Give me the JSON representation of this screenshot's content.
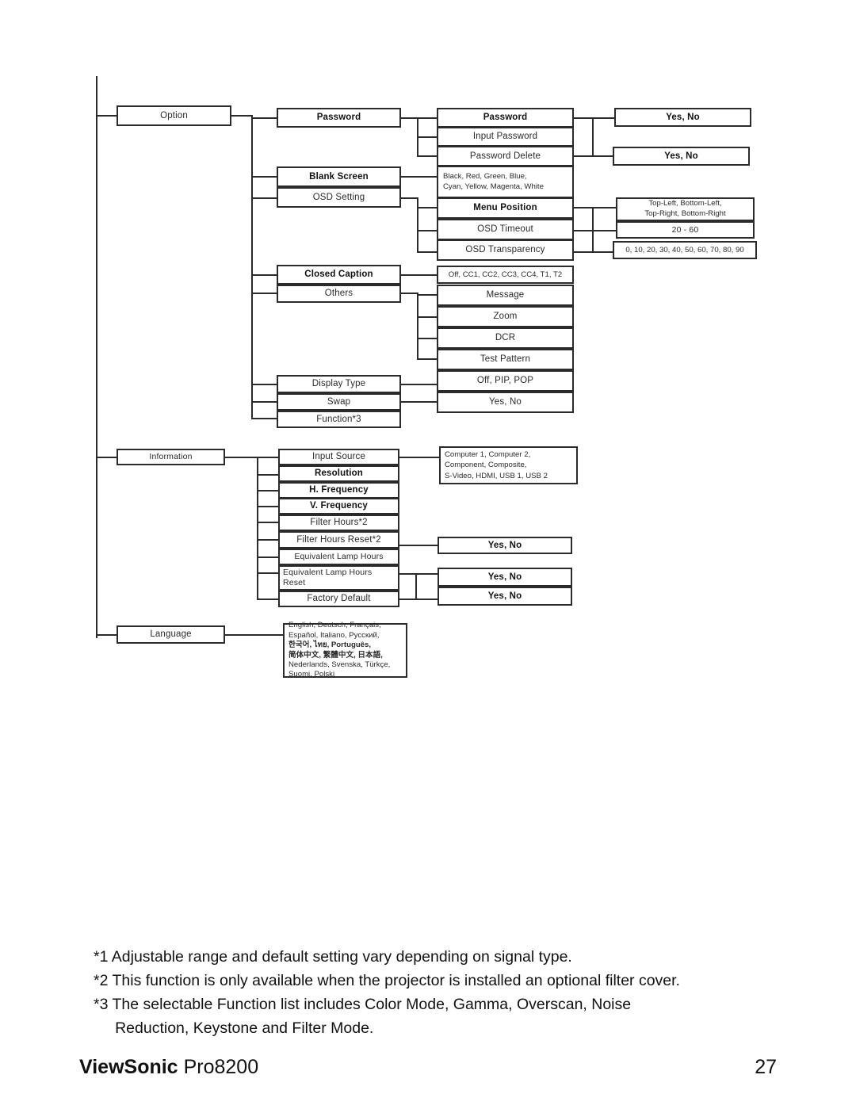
{
  "document": {
    "page_number": "27",
    "brand": "ViewSonic",
    "model": "Pro8200"
  },
  "footnotes": [
    "*1 Adjustable range and default setting vary depending on signal type.",
    "*2 This function is only available when the projector is installed an optional filter cover.",
    "*3 The selectable Function list includes Color Mode, Gamma, Overscan, Noise",
    "     Reduction, Keystone and Filter Mode."
  ],
  "menu_tree": {
    "level1": [
      {
        "id": "option",
        "label": "Option"
      },
      {
        "id": "information",
        "label": "Information"
      },
      {
        "id": "language",
        "label": "Language"
      }
    ],
    "option_items": [
      {
        "id": "password",
        "label": "Password"
      },
      {
        "id": "blank-screen",
        "label": "Blank Screen"
      },
      {
        "id": "osd-setting",
        "label": "OSD Setting"
      },
      {
        "id": "closed-caption",
        "label": "Closed Caption"
      },
      {
        "id": "others",
        "label": "Others"
      },
      {
        "id": "display-type",
        "label": "Display Type"
      },
      {
        "id": "swap",
        "label": "Swap"
      },
      {
        "id": "function3",
        "label": "Function*3"
      }
    ],
    "password_sub": [
      {
        "id": "password-sub",
        "label": "Password"
      },
      {
        "id": "input-password",
        "label": "Input Password"
      },
      {
        "id": "password-delete",
        "label": "Password Delete"
      }
    ],
    "blank_screen_values": "Black, Red, Green, Blue,\nCyan, Yellow, Magenta, White",
    "osd_setting_sub": [
      {
        "id": "menu-position",
        "label": "Menu Position"
      },
      {
        "id": "osd-timeout",
        "label": "OSD Timeout"
      },
      {
        "id": "osd-transparency",
        "label": "OSD Transparency"
      }
    ],
    "closed_caption_values": "Off, CC1, CC2, CC3, CC4, T1, T2",
    "others_sub": [
      {
        "id": "message",
        "label": "Message"
      },
      {
        "id": "zoom",
        "label": "Zoom"
      },
      {
        "id": "dcr",
        "label": "DCR"
      },
      {
        "id": "test-pattern",
        "label": "Test Pattern"
      }
    ],
    "display_type_values": "Off, PIP, POP",
    "swap_values": "Yes, No",
    "password_yes_no": "Yes, No",
    "password_delete_yes_no": "Yes, No",
    "menu_position_values": "Top-Left, Bottom-Left,\nTop-Right, Bottom-Right",
    "osd_timeout_values": "20 - 60",
    "osd_transparency_values": "0, 10, 20, 30, 40, 50, 60, 70, 80, 90",
    "information_items": [
      {
        "id": "input-source",
        "label": "Input Source"
      },
      {
        "id": "resolution",
        "label": "Resolution"
      },
      {
        "id": "h-frequency",
        "label": "H. Frequency"
      },
      {
        "id": "v-frequency",
        "label": "V. Frequency"
      },
      {
        "id": "filter-hours",
        "label": "Filter Hours*2"
      },
      {
        "id": "filter-hours-reset",
        "label": "Filter Hours Reset*2"
      },
      {
        "id": "equivalent-lamp-hours",
        "label": "Equivalent Lamp Hours"
      },
      {
        "id": "equivalent-lamp-hours-reset",
        "label": "Equivalent Lamp Hours\nReset"
      },
      {
        "id": "factory-default",
        "label": "Factory Default"
      }
    ],
    "input_source_values": "Computer  1, Computer 2,\nComponent, Composite,\nS-Video, HDMI, USB 1, USB 2",
    "filter_hours_reset_yes_no": "Yes, No",
    "lamp_hours_reset_yes_no": "Yes, No",
    "factory_default_yes_no": "Yes, No",
    "language_values": [
      "English, Deutsch, Français,",
      "Español, Italiano, Русский,",
      "한국어, ไทย, Português,",
      "简体中文, 繁體中文, 日本語,",
      "Nederlands, Svenska, Türkçe,",
      "Suomi, Polski"
    ]
  }
}
